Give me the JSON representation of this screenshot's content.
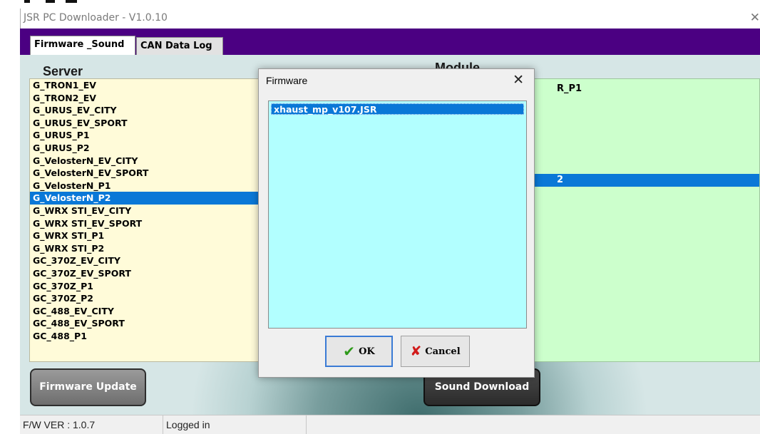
{
  "window": {
    "title": "JSR PC Downloader - V1.0.10",
    "close_glyph": "✕"
  },
  "tabs": [
    {
      "label": "Firmware _Sound",
      "active": true
    },
    {
      "label": "CAN Data Log",
      "active": false
    }
  ],
  "server": {
    "heading": "Server",
    "items": [
      "G_TRON1_EV",
      "G_TRON2_EV",
      "G_URUS_EV_CITY",
      "G_URUS_EV_SPORT",
      "G_URUS_P1",
      "G_URUS_P2",
      "G_VelosterN_EV_CITY",
      "G_VelosterN_EV_SPORT",
      "G_VelosterN_P1",
      "G_VelosterN_P2",
      "G_WRX STI_EV_CITY",
      "G_WRX STI_EV_SPORT",
      "G_WRX STI_P1",
      "G_WRX STI_P2",
      "GC_370Z_EV_CITY",
      "GC_370Z_EV_SPORT",
      "GC_370Z_P1",
      "GC_370Z_P2",
      "GC_488_EV_CITY",
      "GC_488_EV_SPORT",
      "GC_488_P1"
    ],
    "selected_index": 9
  },
  "module": {
    "heading": "Module",
    "visible_fragments": [
      {
        "text": "R_P1",
        "selected": false
      },
      {
        "text": "2",
        "selected": true
      }
    ]
  },
  "buttons": {
    "firmware_update": "Firmware Update",
    "sound_download": "Sound Download"
  },
  "status": {
    "fw_ver": "F/W VER : 1.0.7",
    "login": "Logged in"
  },
  "dialog": {
    "title": "Firmware",
    "close_glyph": "✕",
    "files": [
      "xhaust_mp_v107.JSR"
    ],
    "ok_label": "OK",
    "cancel_label": "Cancel",
    "ok_icon": "checkmark-icon",
    "cancel_icon": "x-mark-icon"
  },
  "colors": {
    "tab_bar": "#4b0082",
    "server_list_bg": "#fffbd9",
    "module_list_bg": "#ccffcc",
    "file_list_bg": "#b2ffff",
    "selection": "#0a78d7"
  }
}
